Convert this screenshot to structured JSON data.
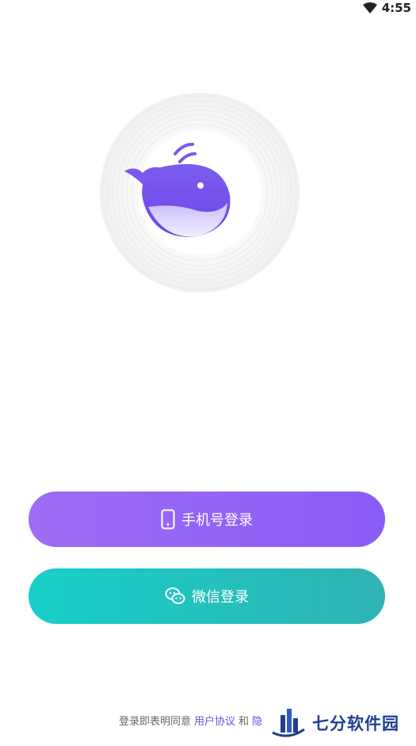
{
  "status_bar": {
    "time": "4:55",
    "wifi_icon": "wifi-icon"
  },
  "logo": {
    "icon": "whale-logo-icon"
  },
  "buttons": {
    "phone_login": {
      "label": "手机号登录",
      "icon": "phone-icon"
    },
    "wechat_login": {
      "label": "微信登录",
      "icon": "wechat-icon"
    }
  },
  "footer": {
    "prefix": "登录即表明同意",
    "user_agreement": "用户协议",
    "and": "和",
    "truncated": "隐"
  },
  "watermark": {
    "text": "七分软件园"
  },
  "colors": {
    "phone_button": "#9166f6",
    "wechat_button": "#1fc4c0",
    "link": "#6a4fd8"
  }
}
